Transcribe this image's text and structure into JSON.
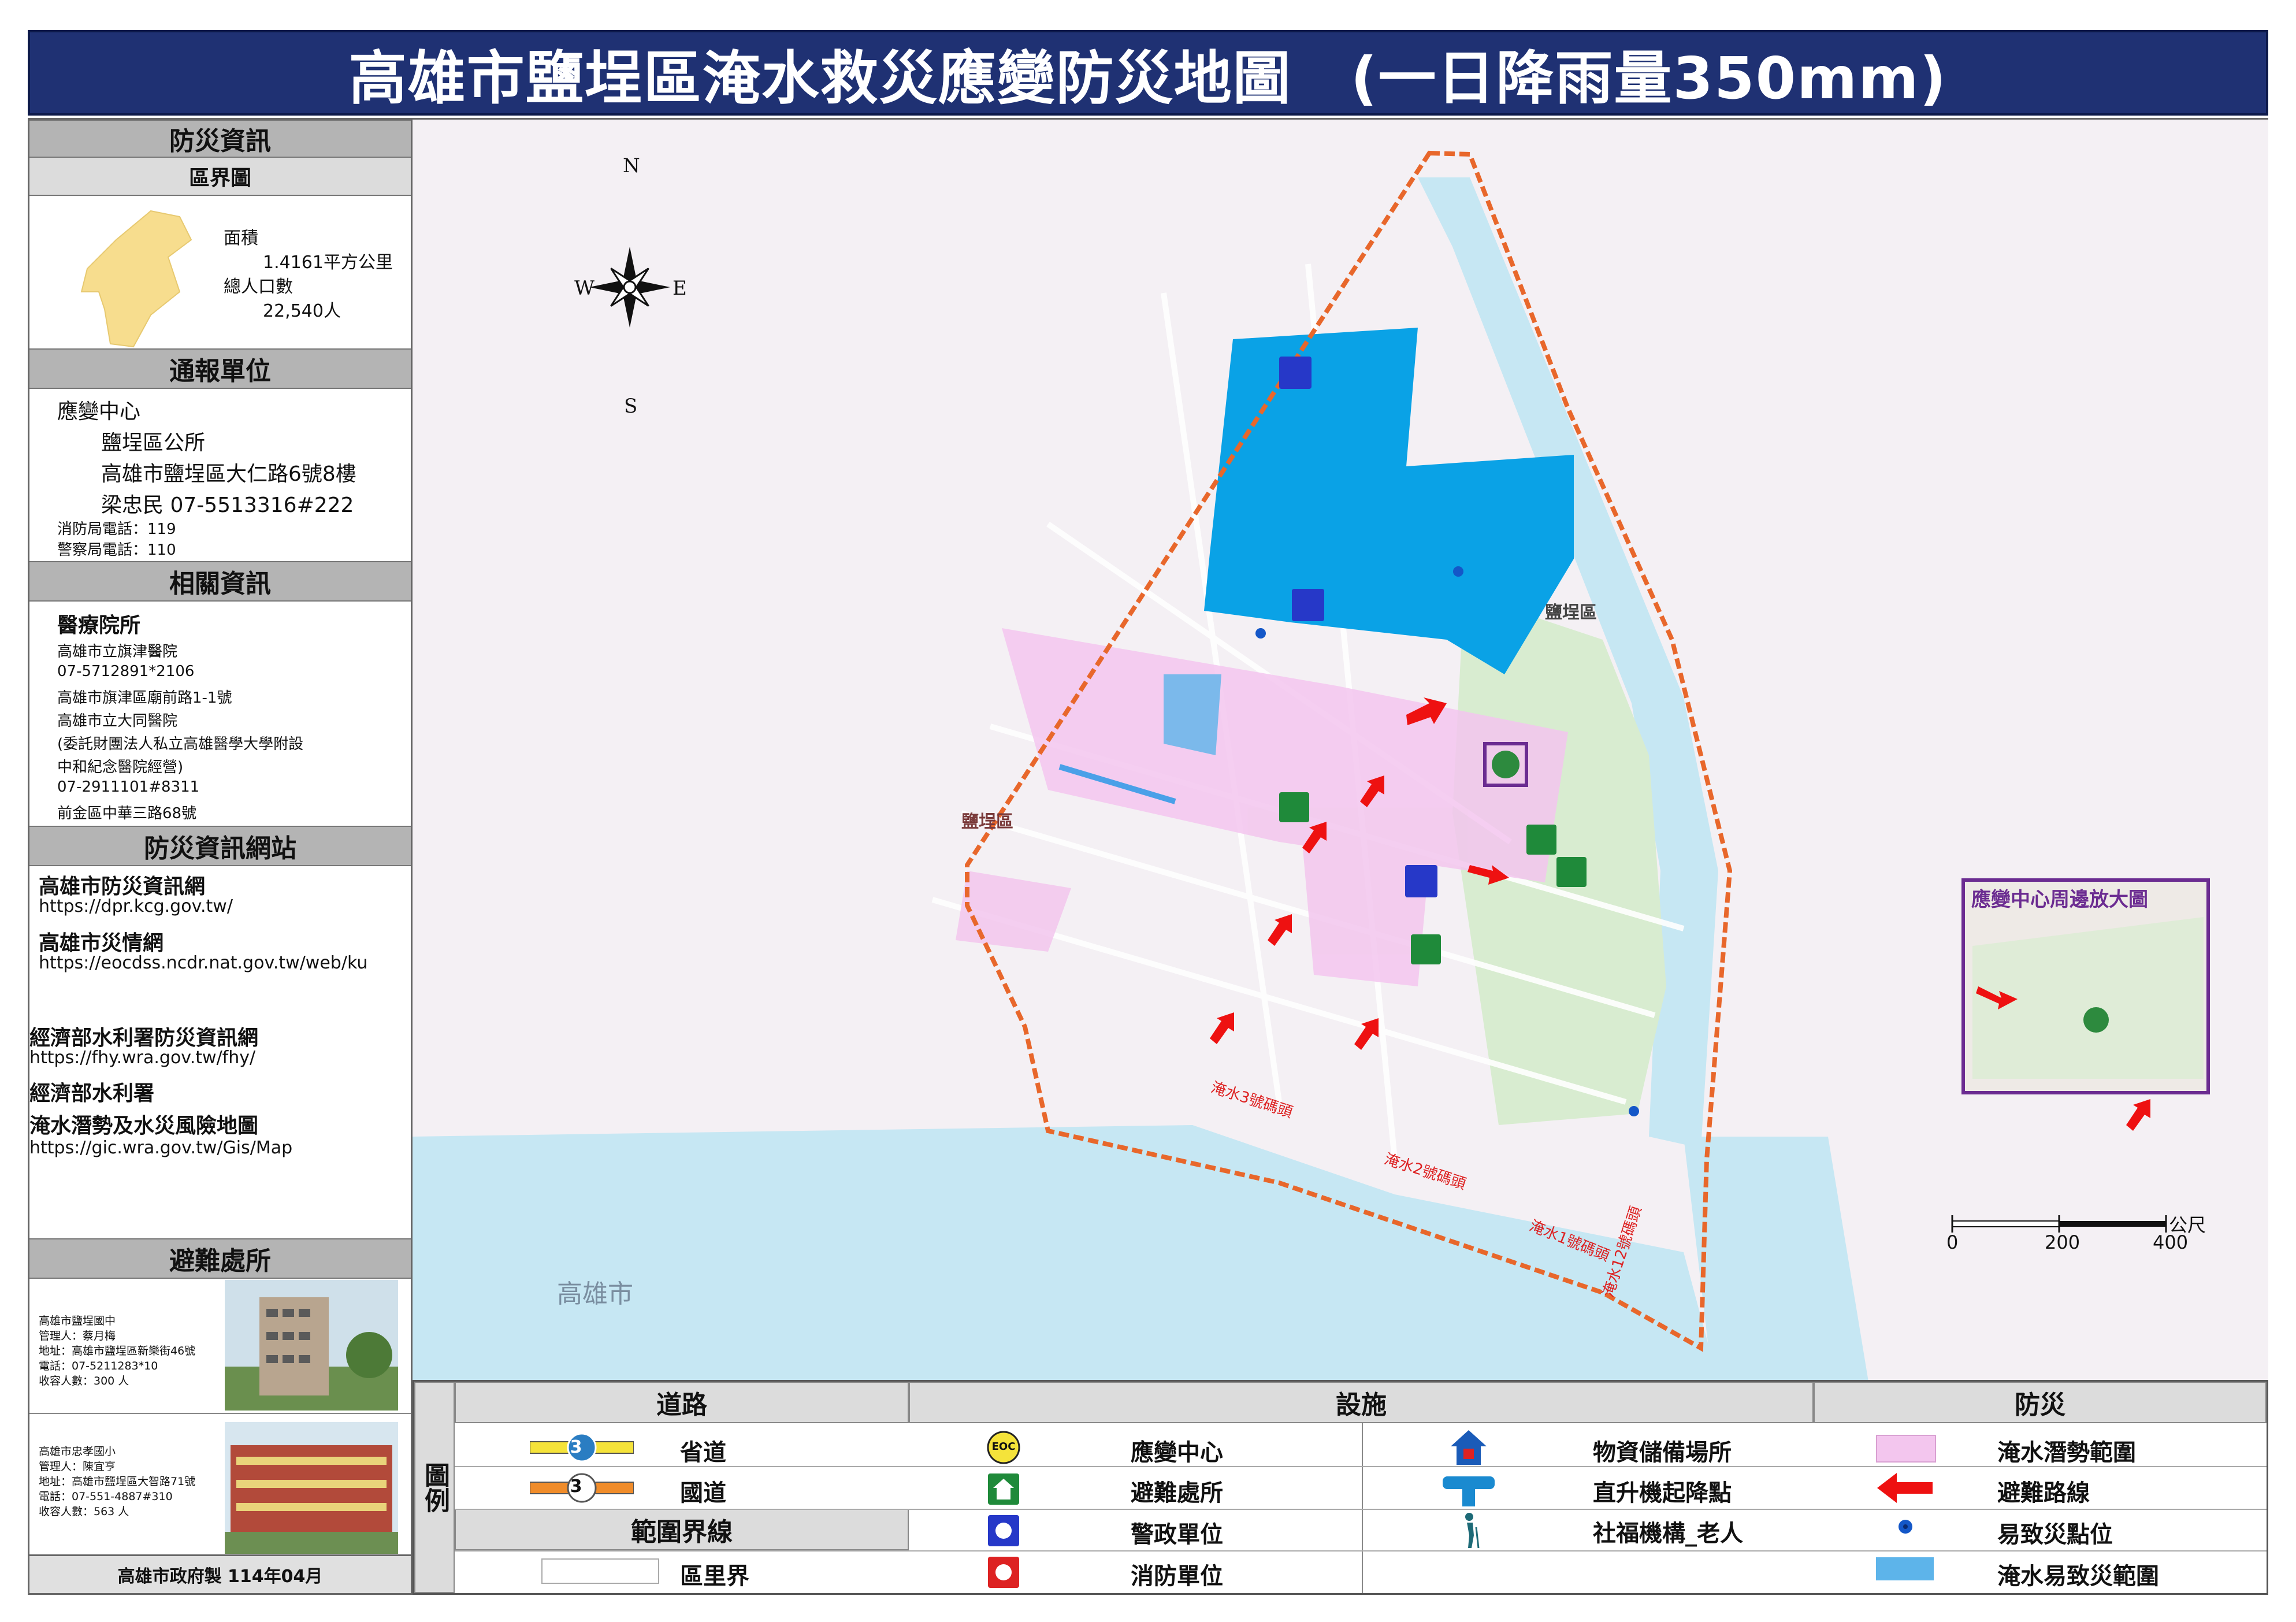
{
  "title": "高雄市鹽埕區淹水救災應變防災地圖　(一日降雨量350mm)",
  "left": {
    "sec_info": "防災資訊",
    "sub_boundary": "區界圖",
    "area_label": "面積",
    "area_value": "1.4161平方公里",
    "pop_label": "總人口數",
    "pop_value": "22,540人",
    "sec_report": "通報單位",
    "report_center": "應變中心",
    "report_office": "鹽埕區公所",
    "report_address": "高雄市鹽埕區大仁路6號8樓",
    "report_contact": "梁忠民  07-5513316#222",
    "fire_phone": "消防局電話：119",
    "police_phone": "警察局電話：110",
    "sec_related": "相關資訊",
    "medical_title": "醫療院所",
    "medical_lines": [
      "高雄市立旗津醫院",
      "07-5712891*2106",
      "高雄市旗津區廟前路1-1號",
      "高雄市立大同醫院",
      "(委託財團法人私立高雄醫學大學附設",
      "中和紀念醫院經營)",
      "07-2911101#8311",
      "前金區中華三路68號"
    ],
    "sec_web": "防災資訊網站",
    "web1_title": "高雄市防災資訊網",
    "web1_url": "https://dpr.kcg.gov.tw/",
    "web2_title": "高雄市災情網",
    "web2_url": "https://eocdss.ncdr.nat.gov.tw/web/ku",
    "web3_title": "經濟部水利署防災資訊網",
    "web3_url": "https://fhy.wra.gov.tw/fhy/",
    "web4_title": "經濟部水利署",
    "web4_title2": "淹水潛勢及水災風險地圖",
    "web4_url": "https://gic.wra.gov.tw/Gis/Map",
    "sec_shelter": "避難處所",
    "shelter1": [
      "高雄市鹽埕國中",
      "管理人：蔡月梅",
      "地址：高雄市鹽埕區新樂街46號",
      "電話：07-5211283*10",
      "收容人數：300 人"
    ],
    "shelter2": [
      "高雄市忠孝國小",
      "管理人：陳宜亨",
      "地址：高雄市鹽埕區大智路71號",
      "電話：07-551-4887#310",
      "收容人數：563 人"
    ],
    "footer": "高雄市政府製  114年04月"
  },
  "map": {
    "district_label": "鹽埕區",
    "city_label": "高雄市",
    "inset_title": "應變中心周邊放大圖",
    "scale_unit": "公尺",
    "scale_ticks": [
      "0",
      "200",
      "400"
    ],
    "compass": {
      "n": "N",
      "s": "S",
      "e": "E",
      "w": "W"
    },
    "pier_labels": [
      "淹水3號碼頭",
      "淹水2號碼頭",
      "淹水1號碼頭",
      "淹水12號碼頭"
    ],
    "colors": {
      "boundary": "#e8672b",
      "flood_zone": "#0aa2e6",
      "potential": "#f3c6ee",
      "arrow": "#ee1111",
      "park": "#d8ecd0",
      "water": "#c6e7f3"
    }
  },
  "legend": {
    "roads_head": "道路",
    "facilities_head": "設施",
    "disaster_head": "防災",
    "boundary_head": "範圍界線",
    "legend_side": "圖例",
    "provincial_road": "省道",
    "provincial_num": "3",
    "national_road": "國道",
    "national_num": "3",
    "village_boundary": "區里界",
    "eoc": "應變中心",
    "eoc_short": "EOC",
    "shelter": "避難處所",
    "police": "警政單位",
    "fire": "消防單位",
    "storage": "物資儲備場所",
    "helipad": "直升機起降點",
    "welfare": "社福機構_老人",
    "flood_potential": "淹水潛勢範圍",
    "evac_route": "避難路線",
    "hotspot": "易致災點位",
    "flood_prone": "淹水易致災範圍"
  }
}
